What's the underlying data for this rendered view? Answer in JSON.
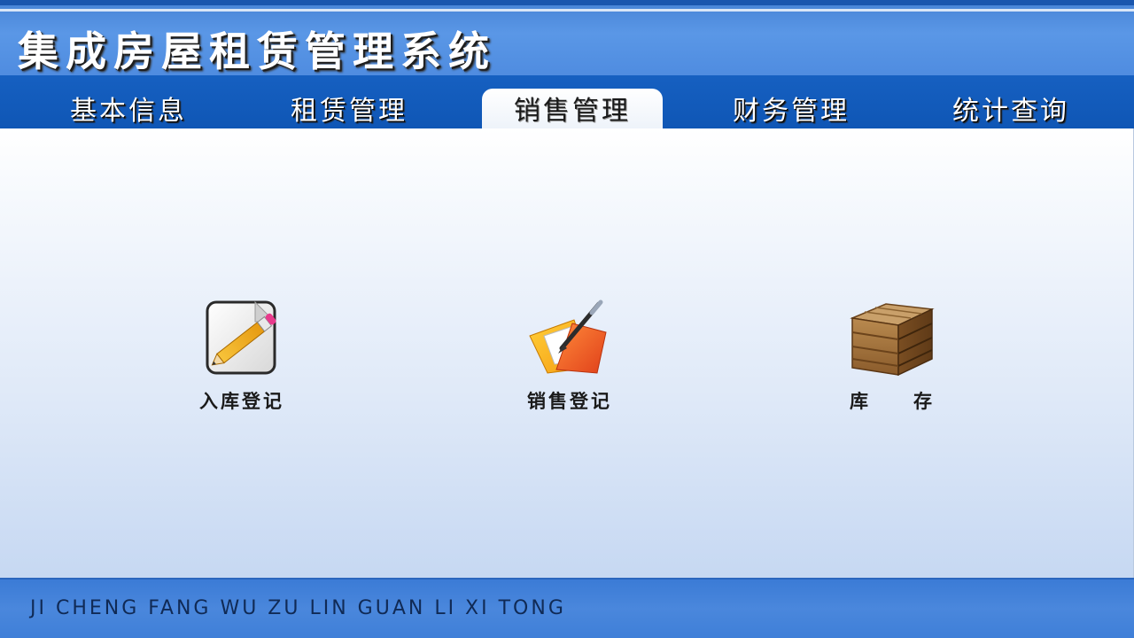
{
  "header": {
    "title": "集成房屋租赁管理系统"
  },
  "nav": {
    "tabs": [
      {
        "label": "基本信息",
        "active": false
      },
      {
        "label": "租赁管理",
        "active": false
      },
      {
        "label": "销售管理",
        "active": true
      },
      {
        "label": "财务管理",
        "active": false
      },
      {
        "label": "统计查询",
        "active": false
      }
    ]
  },
  "functions": [
    {
      "label": "入库登记",
      "icon": "edit-document-pencil-icon"
    },
    {
      "label": "销售登记",
      "icon": "folder-pen-icon"
    },
    {
      "label": "库　　存",
      "icon": "wooden-crate-icon"
    }
  ],
  "footer": {
    "text": "JI CHENG FANG WU ZU LIN GUAN LI XI TONG"
  },
  "colors": {
    "header_blue": "#5a97e6",
    "nav_blue": "#1660c1",
    "footer_blue": "#4a87dc"
  }
}
